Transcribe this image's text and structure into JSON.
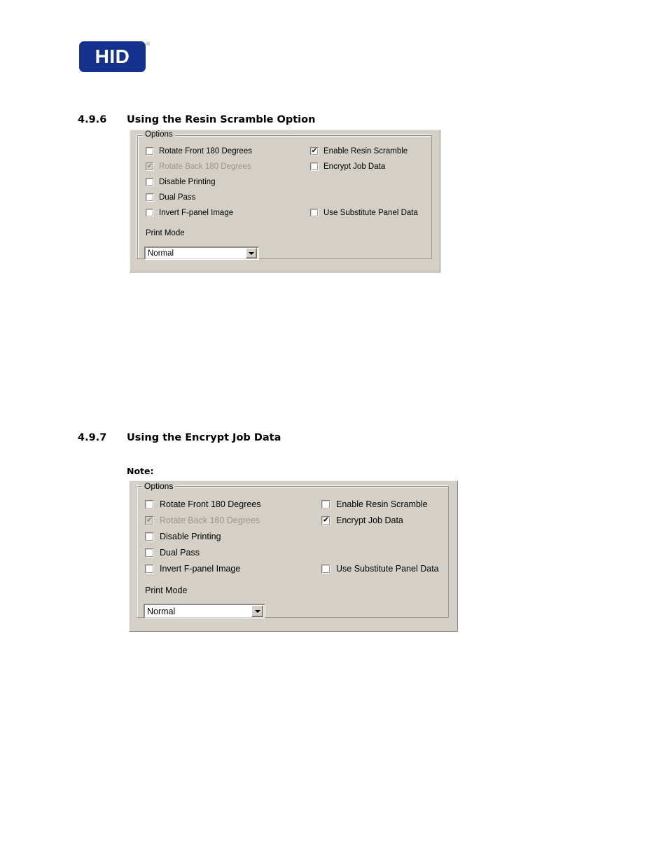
{
  "brand": {
    "logo_text": "HID",
    "registered_mark": "®"
  },
  "sections": [
    {
      "number": "4.9.6",
      "title": "Using the Resin Scramble Option"
    },
    {
      "number": "4.9.7",
      "title": "Using the Encrypt Job Data",
      "note_label": "Note:"
    }
  ],
  "dialogs": [
    {
      "groupbox_legend": "Options",
      "left_column": [
        {
          "label": "Rotate Front 180 Degrees",
          "checked": false,
          "disabled": false
        },
        {
          "label": "Rotate Back 180 Degrees",
          "checked": true,
          "disabled": true
        },
        {
          "label": "Disable Printing",
          "checked": false,
          "disabled": false
        },
        {
          "label": "Dual Pass",
          "checked": false,
          "disabled": false
        },
        {
          "label": "Invert F-panel Image",
          "checked": false,
          "disabled": false
        }
      ],
      "right_column": [
        {
          "label": "Enable Resin Scramble",
          "checked": true,
          "disabled": false
        },
        {
          "label": "Encrypt Job Data",
          "checked": false,
          "disabled": false
        },
        {
          "label": "Use Substitute Panel Data",
          "checked": false,
          "disabled": false
        }
      ],
      "print_mode_label": "Print Mode",
      "print_mode_value": "Normal",
      "print_mode_options": [
        "Normal"
      ]
    },
    {
      "groupbox_legend": "Options",
      "left_column": [
        {
          "label": "Rotate Front 180 Degrees",
          "checked": false,
          "disabled": false
        },
        {
          "label": "Rotate Back 180 Degrees",
          "checked": true,
          "disabled": true
        },
        {
          "label": "Disable Printing",
          "checked": false,
          "disabled": false
        },
        {
          "label": "Dual Pass",
          "checked": false,
          "disabled": false
        },
        {
          "label": "Invert F-panel Image",
          "checked": false,
          "disabled": false
        }
      ],
      "right_column": [
        {
          "label": "Enable Resin Scramble",
          "checked": false,
          "disabled": false
        },
        {
          "label": "Encrypt Job Data",
          "checked": true,
          "disabled": false
        },
        {
          "label": "Use Substitute Panel Data",
          "checked": false,
          "disabled": false
        }
      ],
      "print_mode_label": "Print Mode",
      "print_mode_value": "Normal",
      "print_mode_options": [
        "Normal"
      ]
    }
  ],
  "colors": {
    "brand_blue": "#15318e",
    "dialog_face": "#d4d0c8",
    "dialog_border": "#9a968f",
    "disabled_text": "#9a968f",
    "page_background": "#ffffff",
    "text": "#000000"
  },
  "checkmark_glyph": "✔"
}
